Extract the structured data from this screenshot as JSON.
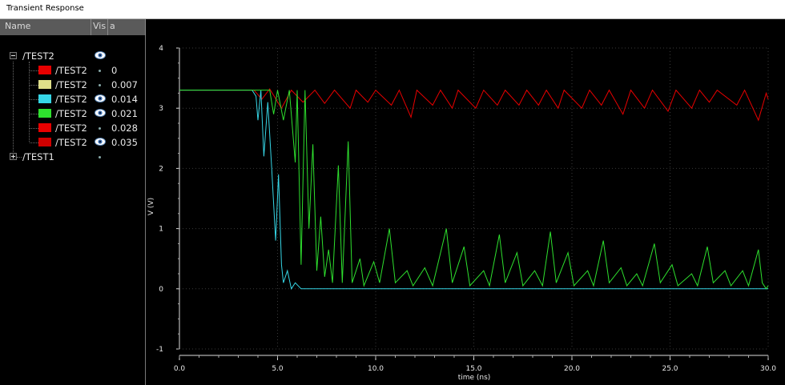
{
  "window": {
    "title": "Transient Response"
  },
  "columns": {
    "name": "Name",
    "vis": "Vis",
    "a": "a"
  },
  "tree": {
    "groups": [
      {
        "label": "/TEST2",
        "expanded": true,
        "visible": true,
        "children": [
          {
            "label": "/TEST2",
            "value": "0",
            "color": "#e80000",
            "visible": false
          },
          {
            "label": "/TEST2",
            "value": "0.007",
            "color": "#e0e08a",
            "visible": false
          },
          {
            "label": "/TEST2",
            "value": "0.014",
            "color": "#36d6e6",
            "visible": true
          },
          {
            "label": "/TEST2",
            "value": "0.021",
            "color": "#2ee02e",
            "visible": true
          },
          {
            "label": "/TEST2",
            "value": "0.028",
            "color": "#e80000",
            "visible": false
          },
          {
            "label": "/TEST2",
            "value": "0.035",
            "color": "#d00000",
            "visible": true
          }
        ]
      },
      {
        "label": "/TEST1",
        "expanded": false,
        "visible": false
      }
    ]
  },
  "icons": {
    "expand": "plus-box-icon",
    "collapse": "minus-box-icon",
    "visible": "eye-icon",
    "hidden": "dot-icon",
    "scroll_left": "left-arrow-icon",
    "scroll_right": "right-arrow-icon",
    "grip": "grip-handle-icon"
  },
  "chart_data": {
    "type": "line",
    "xlabel": "time (ns)",
    "ylabel": "V (V)",
    "xlim": [
      0,
      30
    ],
    "ylim": [
      -1,
      4
    ],
    "x_ticks": [
      "0.0",
      "5.0",
      "10.0",
      "15.0",
      "20.0",
      "25.0",
      "30.0"
    ],
    "y_ticks": [
      "4",
      "3",
      "2",
      "1",
      "0",
      "-1"
    ],
    "grid": true,
    "series": [
      {
        "color": "#e80000",
        "points": [
          [
            0,
            3.3
          ],
          [
            3.8,
            3.3
          ],
          [
            4.2,
            3.15
          ],
          [
            4.6,
            3.32
          ],
          [
            5.2,
            3.0
          ],
          [
            5.7,
            3.3
          ],
          [
            6.3,
            3.1
          ],
          [
            6.9,
            3.3
          ],
          [
            7.4,
            3.08
          ],
          [
            7.9,
            3.3
          ],
          [
            8.7,
            3.0
          ],
          [
            9.0,
            3.3
          ],
          [
            9.6,
            3.1
          ],
          [
            10.0,
            3.3
          ],
          [
            10.8,
            3.05
          ],
          [
            11.2,
            3.3
          ],
          [
            11.8,
            2.85
          ],
          [
            12.1,
            3.3
          ],
          [
            12.9,
            3.05
          ],
          [
            13.3,
            3.3
          ],
          [
            13.9,
            3.0
          ],
          [
            14.2,
            3.3
          ],
          [
            15.1,
            3.0
          ],
          [
            15.5,
            3.3
          ],
          [
            16.2,
            3.05
          ],
          [
            16.6,
            3.3
          ],
          [
            17.3,
            3.05
          ],
          [
            17.7,
            3.3
          ],
          [
            18.3,
            3.05
          ],
          [
            18.7,
            3.3
          ],
          [
            19.3,
            3.0
          ],
          [
            19.6,
            3.3
          ],
          [
            20.5,
            3.0
          ],
          [
            20.9,
            3.3
          ],
          [
            21.5,
            3.05
          ],
          [
            21.9,
            3.3
          ],
          [
            22.6,
            2.9
          ],
          [
            23.0,
            3.3
          ],
          [
            23.7,
            3.0
          ],
          [
            24.1,
            3.3
          ],
          [
            24.9,
            2.95
          ],
          [
            25.3,
            3.3
          ],
          [
            26.1,
            3.0
          ],
          [
            26.5,
            3.3
          ],
          [
            27.0,
            3.1
          ],
          [
            27.4,
            3.3
          ],
          [
            28.4,
            3.05
          ],
          [
            28.8,
            3.3
          ],
          [
            29.5,
            2.8
          ],
          [
            29.9,
            3.25
          ],
          [
            30,
            3.15
          ]
        ]
      },
      {
        "color": "#36d6e6",
        "points": [
          [
            0,
            3.3
          ],
          [
            3.7,
            3.3
          ],
          [
            3.9,
            3.2
          ],
          [
            4.0,
            2.8
          ],
          [
            4.15,
            3.3
          ],
          [
            4.3,
            2.2
          ],
          [
            4.5,
            3.1
          ],
          [
            4.7,
            2.0
          ],
          [
            4.9,
            0.8
          ],
          [
            5.05,
            1.9
          ],
          [
            5.2,
            0.4
          ],
          [
            5.3,
            0.1
          ],
          [
            5.5,
            0.3
          ],
          [
            5.7,
            0.0
          ],
          [
            5.9,
            0.1
          ],
          [
            6.2,
            0.0
          ],
          [
            30,
            0.0
          ]
        ]
      },
      {
        "color": "#2ee02e",
        "points": [
          [
            0,
            3.3
          ],
          [
            4.6,
            3.3
          ],
          [
            4.8,
            2.9
          ],
          [
            5.0,
            3.3
          ],
          [
            5.3,
            2.8
          ],
          [
            5.6,
            3.3
          ],
          [
            5.9,
            2.1
          ],
          [
            6.0,
            3.3
          ],
          [
            6.2,
            0.4
          ],
          [
            6.4,
            3.3
          ],
          [
            6.6,
            1.0
          ],
          [
            6.8,
            2.4
          ],
          [
            7.0,
            0.3
          ],
          [
            7.2,
            1.2
          ],
          [
            7.4,
            0.2
          ],
          [
            7.6,
            0.65
          ],
          [
            7.8,
            0.1
          ],
          [
            8.1,
            2.05
          ],
          [
            8.3,
            0.1
          ],
          [
            8.6,
            2.45
          ],
          [
            8.8,
            0.1
          ],
          [
            9.2,
            0.5
          ],
          [
            9.4,
            0.05
          ],
          [
            9.9,
            0.45
          ],
          [
            10.2,
            0.1
          ],
          [
            10.7,
            1.0
          ],
          [
            11.0,
            0.1
          ],
          [
            11.6,
            0.3
          ],
          [
            11.9,
            0.05
          ],
          [
            12.5,
            0.35
          ],
          [
            12.9,
            0.05
          ],
          [
            13.6,
            1.0
          ],
          [
            13.9,
            0.1
          ],
          [
            14.5,
            0.7
          ],
          [
            14.8,
            0.05
          ],
          [
            15.5,
            0.3
          ],
          [
            15.8,
            0.05
          ],
          [
            16.3,
            0.9
          ],
          [
            16.6,
            0.1
          ],
          [
            17.2,
            0.6
          ],
          [
            17.5,
            0.05
          ],
          [
            18.1,
            0.3
          ],
          [
            18.5,
            0.05
          ],
          [
            18.9,
            0.95
          ],
          [
            19.2,
            0.1
          ],
          [
            19.8,
            0.6
          ],
          [
            20.1,
            0.05
          ],
          [
            20.8,
            0.3
          ],
          [
            21.1,
            0.05
          ],
          [
            21.6,
            0.8
          ],
          [
            21.9,
            0.1
          ],
          [
            22.5,
            0.35
          ],
          [
            22.8,
            0.05
          ],
          [
            23.3,
            0.25
          ],
          [
            23.6,
            0.05
          ],
          [
            24.2,
            0.75
          ],
          [
            24.5,
            0.1
          ],
          [
            25.1,
            0.4
          ],
          [
            25.4,
            0.05
          ],
          [
            26.1,
            0.25
          ],
          [
            26.4,
            0.05
          ],
          [
            26.9,
            0.7
          ],
          [
            27.2,
            0.1
          ],
          [
            27.8,
            0.3
          ],
          [
            28.1,
            0.05
          ],
          [
            28.7,
            0.3
          ],
          [
            29.0,
            0.05
          ],
          [
            29.5,
            0.65
          ],
          [
            29.7,
            0.1
          ],
          [
            29.9,
            0.0
          ],
          [
            30,
            0.05
          ]
        ]
      }
    ]
  }
}
